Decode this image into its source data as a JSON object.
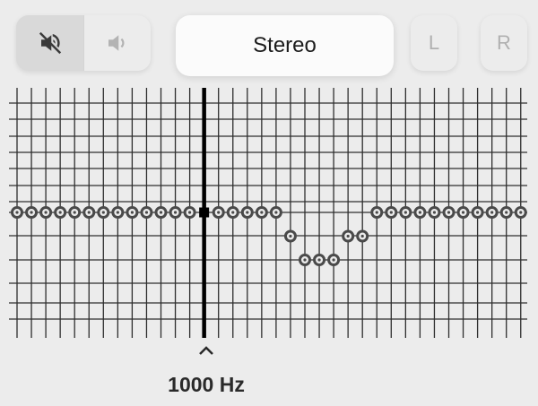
{
  "toolbar": {
    "mute_icon": "speaker-muted-icon",
    "unmute_icon": "speaker-on-icon",
    "mode_label": "Stereo",
    "left_label": "L",
    "right_label": "R",
    "active_color": "#3a3a3a",
    "inactive_color": "#b3b3b3"
  },
  "equalizer": {
    "band_count": 36,
    "selected_band": 13,
    "band_levels": [
      0,
      0,
      0,
      0,
      0,
      0,
      0,
      0,
      0,
      0,
      0,
      0,
      0,
      0,
      0,
      0,
      0,
      0,
      0,
      -1,
      -2,
      -2,
      -2,
      -1,
      -1,
      0,
      0,
      0,
      0,
      0,
      0,
      0,
      0,
      0,
      0,
      0
    ],
    "selected_frequency": "1000 Hz",
    "grid_color": "#2e2e2e",
    "handle_color": "#4a4a4a"
  }
}
